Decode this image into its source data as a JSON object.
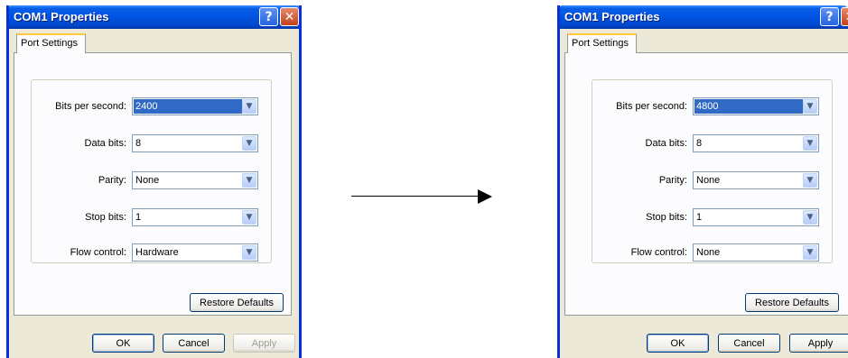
{
  "left_dialog": {
    "title": "COM1 Properties",
    "tab": "Port Settings",
    "fields": [
      {
        "label": "Bits per second:",
        "value": "2400",
        "selected": true
      },
      {
        "label": "Data bits:",
        "value": "8"
      },
      {
        "label": "Parity:",
        "value": "None"
      },
      {
        "label": "Stop bits:",
        "value": "1"
      },
      {
        "label": "Flow control:",
        "value": "Hardware"
      }
    ],
    "restore_defaults": "Restore Defaults",
    "ok": "OK",
    "cancel": "Cancel",
    "apply": "Apply",
    "apply_enabled": false
  },
  "right_dialog": {
    "title": "COM1 Properties",
    "tab": "Port Settings",
    "fields": [
      {
        "label": "Bits per second:",
        "value": "4800",
        "selected": true
      },
      {
        "label": "Data bits:",
        "value": "8"
      },
      {
        "label": "Parity:",
        "value": "None"
      },
      {
        "label": "Stop bits:",
        "value": "1"
      },
      {
        "label": "Flow control:",
        "value": "None"
      }
    ],
    "restore_defaults": "Restore Defaults",
    "ok": "OK",
    "cancel": "Cancel",
    "apply": "Apply",
    "apply_enabled": true
  },
  "icons": {
    "help": "?",
    "close": "✕",
    "dropdown": "▼"
  },
  "colors": {
    "title_bar": "#0054e3",
    "selection": "#316ac5",
    "dialog_bg": "#ece9d8"
  }
}
